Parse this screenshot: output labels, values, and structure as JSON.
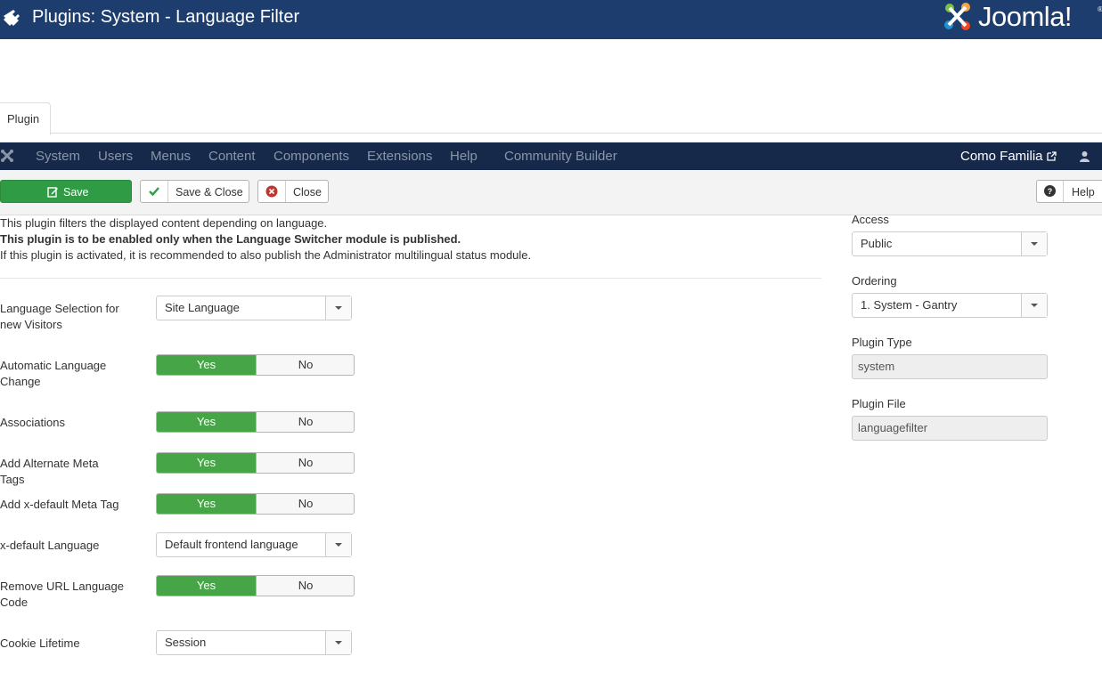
{
  "header": {
    "title": "Plugins: System - Language Filter",
    "brand": "Joomla!",
    "reg": "®",
    "color": "#1c3d6e"
  },
  "tabs": [
    {
      "label": "Plugin"
    }
  ],
  "adminmenu": {
    "items": [
      "System",
      "Users",
      "Menus",
      "Content",
      "Components",
      "Extensions",
      "Help",
      "Community Builder"
    ],
    "site_name": "Como Familia"
  },
  "toolbar": {
    "save": "Save",
    "save_close": "Save & Close",
    "close": "Close",
    "help": "Help"
  },
  "description": {
    "line1": "This plugin filters the displayed content depending on language.",
    "line2": "This plugin is to be enabled only when the Language Switcher module is published.",
    "line3": "If this plugin is activated, it is recommended to also publish the Administrator multilingual status module."
  },
  "form": {
    "language_selection": {
      "label_1": "Language Selection for",
      "label_2": "new Visitors",
      "value": "Site Language"
    },
    "automatic_change": {
      "label_1": "Automatic Language",
      "label_2": "Change",
      "yes": "Yes",
      "no": "No"
    },
    "associations": {
      "label": "Associations",
      "yes": "Yes",
      "no": "No"
    },
    "alternate_meta": {
      "label": "Add Alternate Meta Tags",
      "yes": "Yes",
      "no": "No"
    },
    "xdefault_meta": {
      "label": "Add x-default Meta Tag",
      "yes": "Yes",
      "no": "No"
    },
    "xdefault_language": {
      "label": "x-default Language",
      "value": "Default frontend language"
    },
    "remove_url_code": {
      "label_1": "Remove URL Language",
      "label_2": "Code",
      "yes": "Yes",
      "no": "No"
    },
    "cookie_lifetime": {
      "label": "Cookie Lifetime",
      "value": "Session"
    }
  },
  "sidebar": {
    "access": {
      "label": "Access",
      "value": "Public"
    },
    "ordering": {
      "label": "Ordering",
      "value": "1. System - Gantry"
    },
    "plugin_type": {
      "label": "Plugin Type",
      "value": "system"
    },
    "plugin_file": {
      "label": "Plugin File",
      "value": "languagefilter"
    }
  }
}
